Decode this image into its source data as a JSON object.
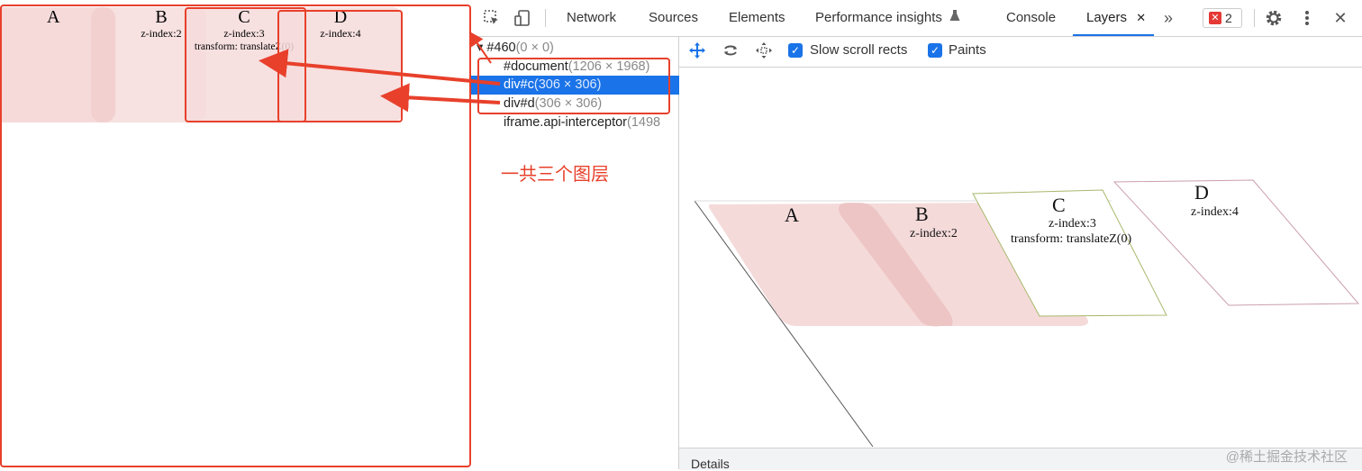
{
  "page": {
    "boxes": {
      "a": {
        "letter": "A"
      },
      "b": {
        "letter": "B",
        "line1": "z-index:2"
      },
      "c": {
        "letter": "C",
        "line1": "z-index:3",
        "line2": "transform: translateZ(0)"
      },
      "d": {
        "letter": "D",
        "line1": "z-index:4"
      }
    }
  },
  "devtools": {
    "tabs": [
      {
        "label": "Network"
      },
      {
        "label": "Sources"
      },
      {
        "label": "Elements"
      },
      {
        "label": "Performance insights"
      },
      {
        "label": "Console"
      },
      {
        "label": "Layers"
      }
    ],
    "active_tab": "Layers",
    "error_count": "2",
    "more_tabs_glyph": "»",
    "close_glyph": "✕"
  },
  "layer_tree": {
    "rows": [
      {
        "name": "#460",
        "dims": "(0 × 0)",
        "prefix": "▾"
      },
      {
        "name": "#document",
        "dims": "(1206 × 1968)"
      },
      {
        "name": "div#c",
        "dims": "(306 × 306)",
        "selected": true
      },
      {
        "name": "div#d",
        "dims": "(306 × 306)"
      },
      {
        "name": "iframe.api-interceptor",
        "dims": "(1498"
      }
    ],
    "annotation": "一共三个图层"
  },
  "layers_toolbar": {
    "slow_scroll_label": "Slow scroll rects",
    "paints_label": "Paints",
    "slow_scroll_checked": true,
    "paints_checked": true
  },
  "layers_view": {
    "a": "A",
    "b": "B",
    "b_z": "z-index:2",
    "c": "C",
    "c_z": "z-index:3",
    "c_t": "transform: translateZ(0)",
    "d": "D",
    "d_z": "z-index:4"
  },
  "details_label": "Details",
  "watermark": "@稀土掘金技术社区",
  "colors": {
    "accent": "#1a73e8",
    "annotation": "#e8402b",
    "box_fill": "#f6dada",
    "error": "#e53935"
  }
}
